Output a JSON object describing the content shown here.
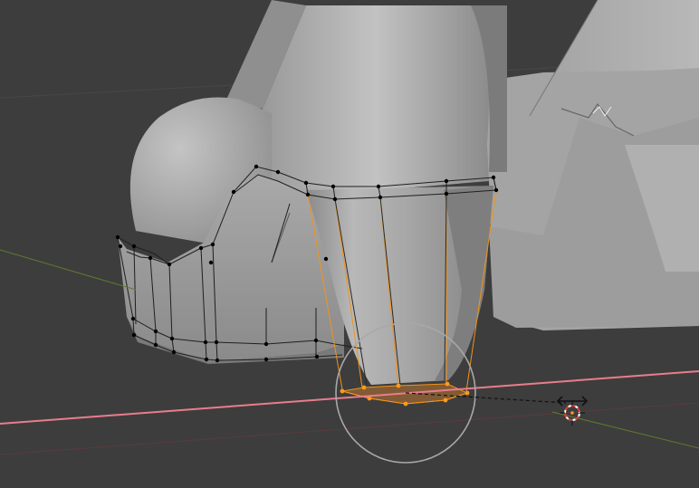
{
  "viewport": {
    "background": "#3d3d3d",
    "x_axis_color": "#e8788a",
    "y_axis_color": "#6f8a3a",
    "mesh_color": "#9f9f9f",
    "selected_color": "#ff9a1a",
    "wire_color": "#1a1a1a",
    "cursor_icon": "3d-cursor-icon",
    "transform_icon": "move-arrows-icon",
    "proportional_circle": "proportional-edit-circle"
  }
}
